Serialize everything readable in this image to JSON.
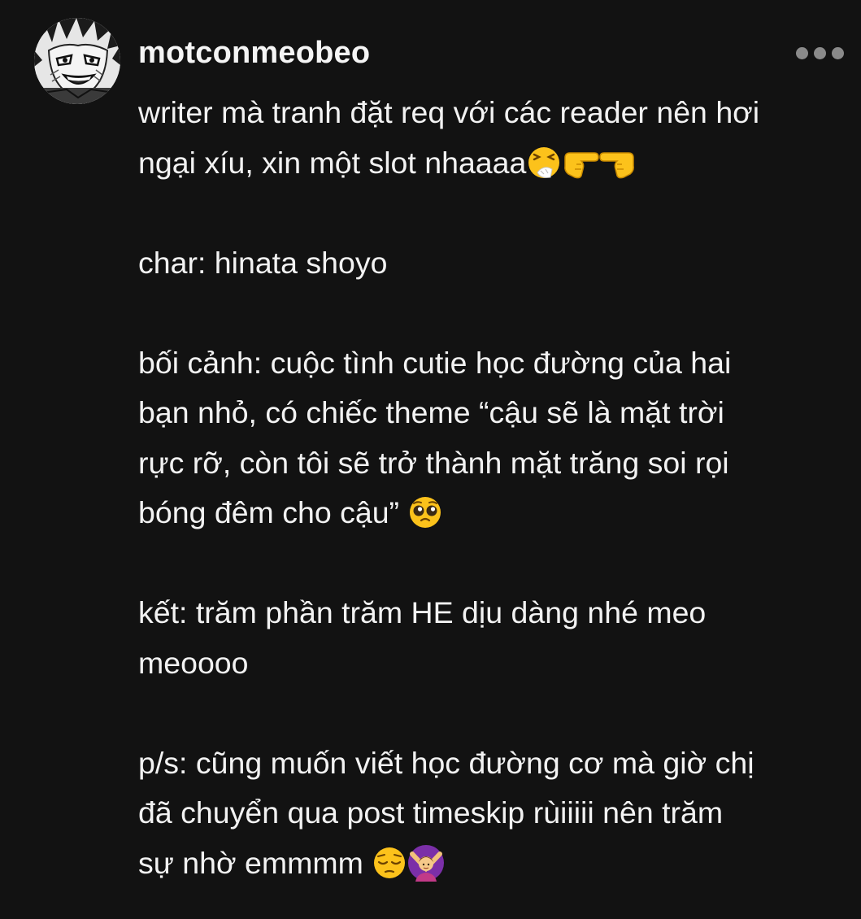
{
  "post": {
    "username": "motconmeobeo",
    "avatar_icon": "manga-character-avatar-icon",
    "more_icon": "more-dots-icon",
    "lines": {
      "l1": "writer mà tranh đặt req với các reader nên hơi",
      "l2": "ngại xíu, xin một slot nhaaaa",
      "l3": "char: hinata shoyo",
      "l4": "bối cảnh: cuộc tình cutie học đường của hai",
      "l5": "bạn nhỏ, có chiếc theme  “cậu sẽ là mặt trời",
      "l6": "rực rỡ, còn tôi sẽ trở thành mặt trăng soi rọi",
      "l7": "bóng đêm cho cậu”",
      "l8": "kết: trăm phần trăm HE dịu dàng nhé meo",
      "l9": "meoooo",
      "l10": "p/s: cũng muốn viết học đường cơ mà giờ chị",
      "l11": "đã chuyển qua post timeskip rùiiiii nên trăm",
      "l12": "sự nhờ emmmm"
    },
    "emojis": {
      "line2": [
        "sneezing-face-emoji",
        "backhand-index-pointing-right-emoji",
        "backhand-index-pointing-left-emoji"
      ],
      "line7": [
        "pleading-face-emoji"
      ],
      "line12": [
        "pensive-face-emoji",
        "person-gesturing-no-emoji"
      ]
    },
    "colors": {
      "background": "#121212",
      "text": "#f2f2f2",
      "muted": "#8a8a8a",
      "emoji_yellow": "#fcc21b"
    }
  }
}
